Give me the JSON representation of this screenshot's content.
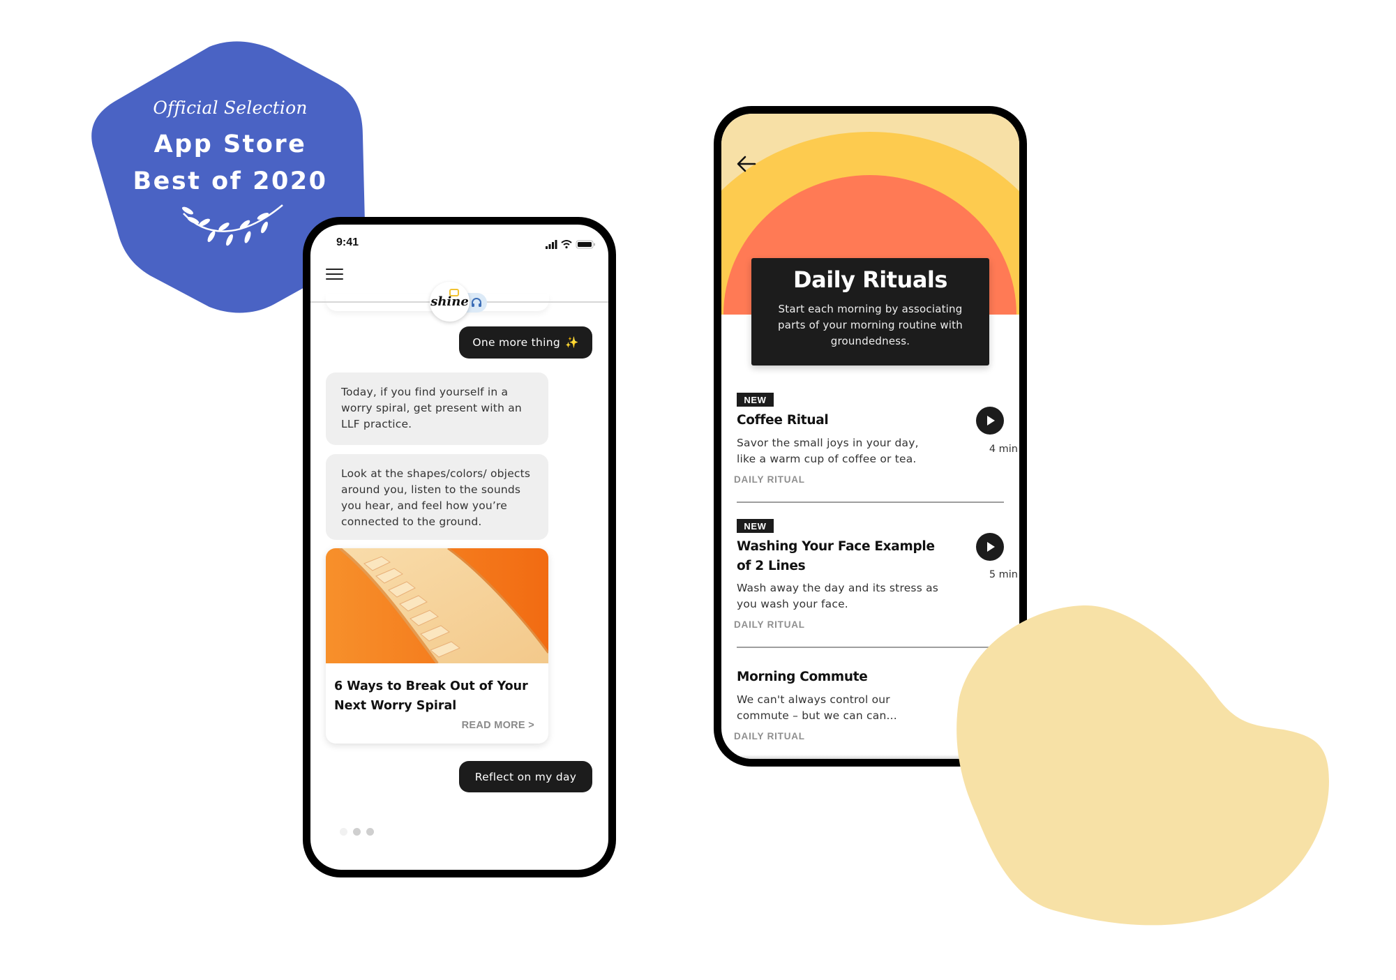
{
  "badge": {
    "line1": "Official Selection",
    "line2": "App Store",
    "line3": "Best of 2020",
    "color": "#4A63C4"
  },
  "left_phone": {
    "status": {
      "time": "9:41"
    },
    "header": {
      "logo_text": "shine",
      "menu_icon": "hamburger-icon",
      "audio_icon": "headphones-icon"
    },
    "chat": {
      "reply_one_more": "One more thing",
      "reply_one_more_emoji": "✨",
      "messages": [
        "Today, if you find yourself in a worry spiral, get present with an LLF practice.",
        "Look at the shapes/colors/ objects around you, listen to the sounds you hear, and feel how you’re connected to the ground."
      ],
      "article": {
        "title": "6 Ways to Break Out of Your Next Worry Spiral",
        "read_more": "READ MORE >"
      },
      "reply_reflect": "Reflect on my day",
      "typing_dots": 3
    }
  },
  "right_phone": {
    "hero": {
      "title": "Daily Rituals",
      "description": "Start each morning by associating parts of your morning routine with groundedness."
    },
    "colors": {
      "sky": "#F7E0A6",
      "sun_outer": "#FDCB4F",
      "sun_inner": "#FF7A55"
    },
    "rituals": [
      {
        "badge": "NEW",
        "title": "Coffee Ritual",
        "description": "Savor the small joys in your day, like a warm cup of coffee or tea.",
        "category": "DAILY RITUAL",
        "duration": "4 min"
      },
      {
        "badge": "NEW",
        "title": "Washing Your Face Example of 2 Lines",
        "description": "Wash away the day and its stress as you wash your face.",
        "category": "DAILY RITUAL",
        "duration": "5 min"
      },
      {
        "badge": "",
        "title": "Morning Commute",
        "description": "We can't always control our commute – but we can can...",
        "category": "DAILY RITUAL",
        "duration": ""
      }
    ]
  },
  "decor": {
    "blob_color": "#F7E1A6"
  }
}
